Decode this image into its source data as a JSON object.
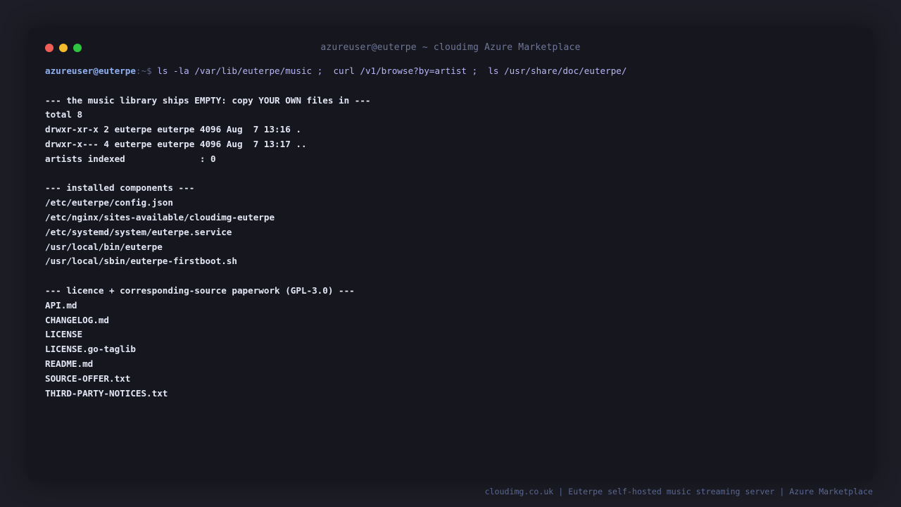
{
  "window": {
    "title": "azureuser@euterpe ~ cloudimg Azure Marketplace",
    "controls": [
      "close",
      "minimize",
      "maximize"
    ]
  },
  "prompt": {
    "user_host": "azureuser@euterpe",
    "path": ":~$",
    "command": " ls -la /var/lib/euterpe/music ;  curl /v1/browse?by=artist ;  ls /usr/share/doc/euterpe/"
  },
  "sections": {
    "music": {
      "header": "--- the music library ships EMPTY: copy YOUR OWN files in ---",
      "lines": [
        "total 8",
        "drwxr-xr-x 2 euterpe euterpe 4096 Aug  7 13:16 .",
        "drwxr-x--- 4 euterpe euterpe 4096 Aug  7 13:17 ..",
        "artists indexed              : 0"
      ]
    },
    "components": {
      "header": "--- installed components ---",
      "lines": [
        "/etc/euterpe/config.json",
        "/etc/nginx/sites-available/cloudimg-euterpe",
        "/etc/systemd/system/euterpe.service",
        "/usr/local/bin/euterpe",
        "/usr/local/sbin/euterpe-firstboot.sh"
      ]
    },
    "licence": {
      "header": "--- licence + corresponding-source paperwork (GPL-3.0) ---",
      "lines": [
        "API.md",
        "CHANGELOG.md",
        "LICENSE",
        "LICENSE.go-taglib",
        "README.md",
        "SOURCE-OFFER.txt",
        "THIRD-PARTY-NOTICES.txt"
      ]
    }
  },
  "footer": "cloudimg.co.uk | Euterpe self-hosted music streaming server | Azure Marketplace",
  "colors": {
    "background": "#1c1d26",
    "terminal": "#15161e",
    "text": "#e3e7f5",
    "prompt_user": "#8fb0f2",
    "command": "#b9b4f5",
    "close": "#f15e57",
    "minimize": "#f5bd2e",
    "maximize": "#2dc63f"
  }
}
